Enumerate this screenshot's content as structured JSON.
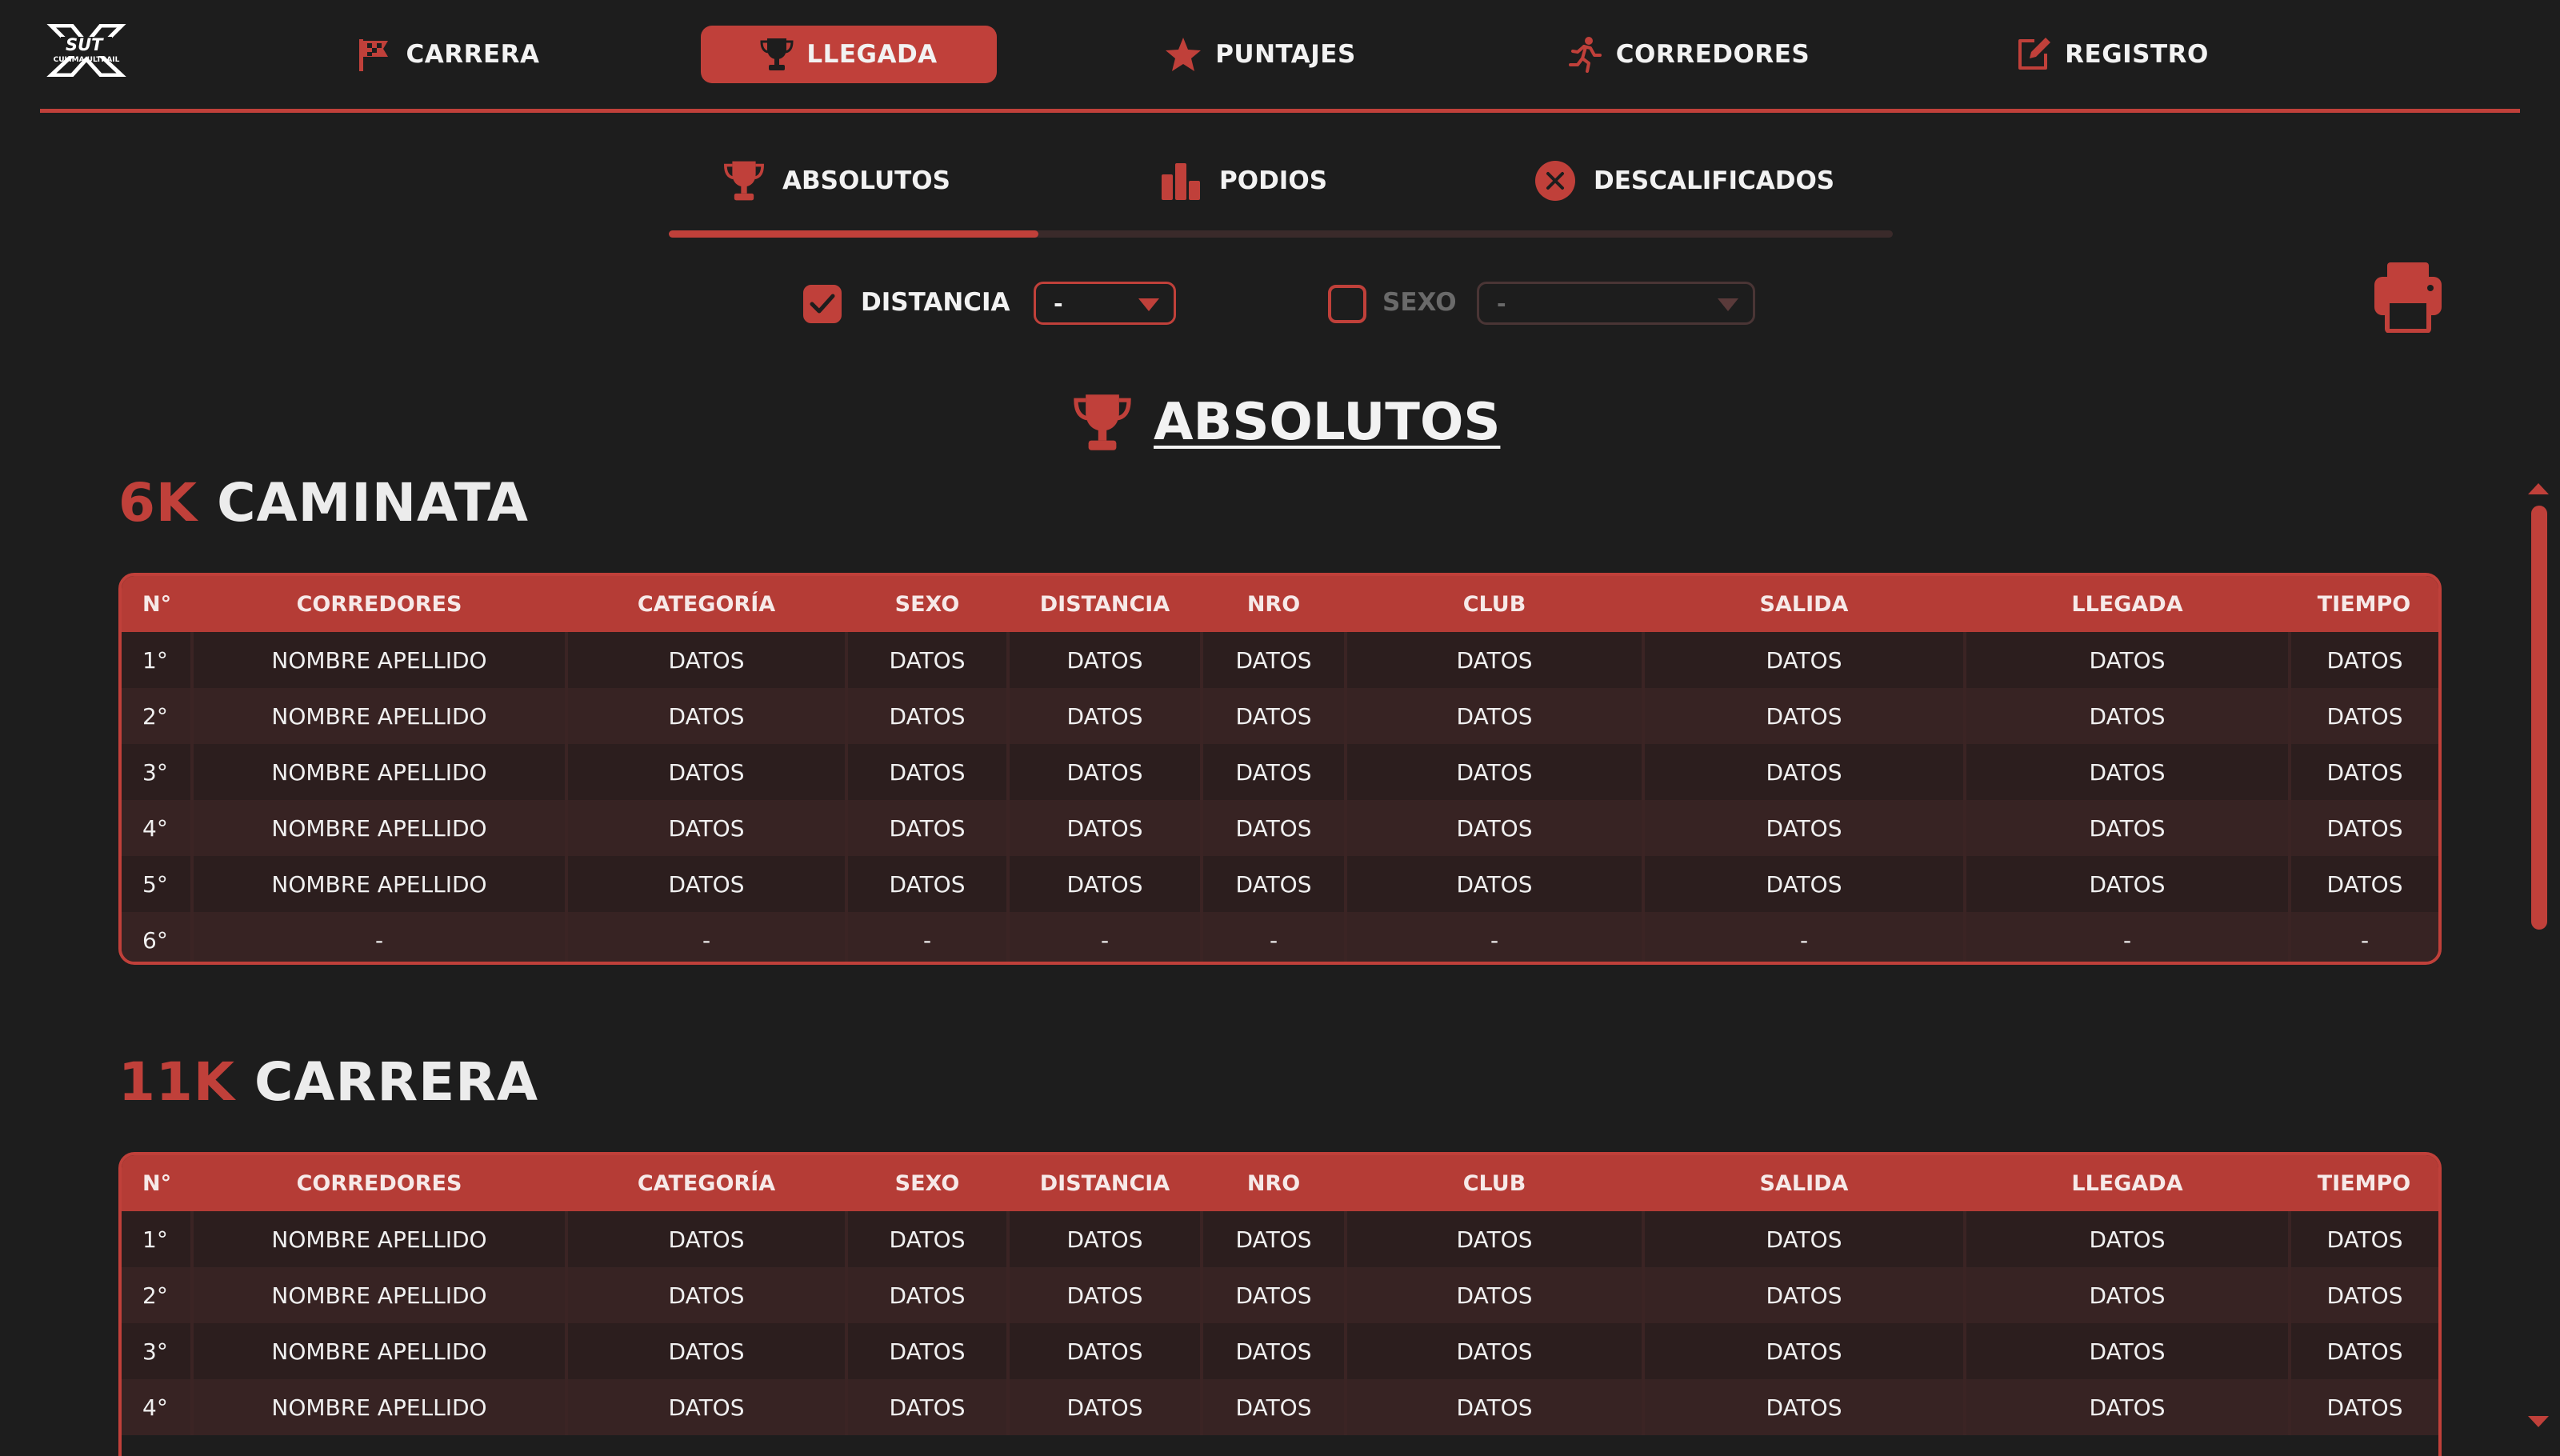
{
  "logo": {
    "top_text": "SUT",
    "sub_text": "CULIMA ULTRAIL"
  },
  "nav": {
    "items": [
      {
        "label": "CARRERA",
        "icon": "flag-icon"
      },
      {
        "label": "LLEGADA",
        "icon": "trophy-icon",
        "active": true
      },
      {
        "label": "PUNTAJES",
        "icon": "star-icon"
      },
      {
        "label": "CORREDORES",
        "icon": "runner-icon"
      },
      {
        "label": "REGISTRO",
        "icon": "edit-icon"
      }
    ]
  },
  "subtabs": {
    "items": [
      {
        "label": "ABSOLUTOS",
        "icon": "trophy-icon",
        "active": true
      },
      {
        "label": "PODIOS",
        "icon": "podium-icon"
      },
      {
        "label": "DESCALIFICADOS",
        "icon": "close-circle-icon"
      }
    ]
  },
  "filters": {
    "distance": {
      "label": "DISTANCIA",
      "checked": true,
      "value": "-"
    },
    "sex": {
      "label": "SEXO",
      "checked": false,
      "value": "-"
    }
  },
  "heading": {
    "title": "ABSOLUTOS"
  },
  "colors": {
    "accent": "#c0403a",
    "background": "#1d1d1d"
  },
  "columns": [
    "N°",
    "CORREDORES",
    "CATEGORÍA",
    "SEXO",
    "DISTANCIA",
    "NRO",
    "CLUB",
    "SALIDA",
    "LLEGADA",
    "TIEMPO"
  ],
  "sections": [
    {
      "distance": "6K",
      "name": "CAMINATA",
      "rows": [
        [
          "1°",
          "NOMBRE APELLIDO",
          "DATOS",
          "DATOS",
          "DATOS",
          "DATOS",
          "DATOS",
          "DATOS",
          "DATOS",
          "DATOS"
        ],
        [
          "2°",
          "NOMBRE APELLIDO",
          "DATOS",
          "DATOS",
          "DATOS",
          "DATOS",
          "DATOS",
          "DATOS",
          "DATOS",
          "DATOS"
        ],
        [
          "3°",
          "NOMBRE APELLIDO",
          "DATOS",
          "DATOS",
          "DATOS",
          "DATOS",
          "DATOS",
          "DATOS",
          "DATOS",
          "DATOS"
        ],
        [
          "4°",
          "NOMBRE APELLIDO",
          "DATOS",
          "DATOS",
          "DATOS",
          "DATOS",
          "DATOS",
          "DATOS",
          "DATOS",
          "DATOS"
        ],
        [
          "5°",
          "NOMBRE APELLIDO",
          "DATOS",
          "DATOS",
          "DATOS",
          "DATOS",
          "DATOS",
          "DATOS",
          "DATOS",
          "DATOS"
        ],
        [
          "6°",
          "-",
          "-",
          "-",
          "-",
          "-",
          "-",
          "-",
          "-",
          "-"
        ]
      ]
    },
    {
      "distance": "11K",
      "name": "CARRERA",
      "rows": [
        [
          "1°",
          "NOMBRE APELLIDO",
          "DATOS",
          "DATOS",
          "DATOS",
          "DATOS",
          "DATOS",
          "DATOS",
          "DATOS",
          "DATOS"
        ],
        [
          "2°",
          "NOMBRE APELLIDO",
          "DATOS",
          "DATOS",
          "DATOS",
          "DATOS",
          "DATOS",
          "DATOS",
          "DATOS",
          "DATOS"
        ],
        [
          "3°",
          "NOMBRE APELLIDO",
          "DATOS",
          "DATOS",
          "DATOS",
          "DATOS",
          "DATOS",
          "DATOS",
          "DATOS",
          "DATOS"
        ],
        [
          "4°",
          "NOMBRE APELLIDO",
          "DATOS",
          "DATOS",
          "DATOS",
          "DATOS",
          "DATOS",
          "DATOS",
          "DATOS",
          "DATOS"
        ]
      ]
    }
  ]
}
